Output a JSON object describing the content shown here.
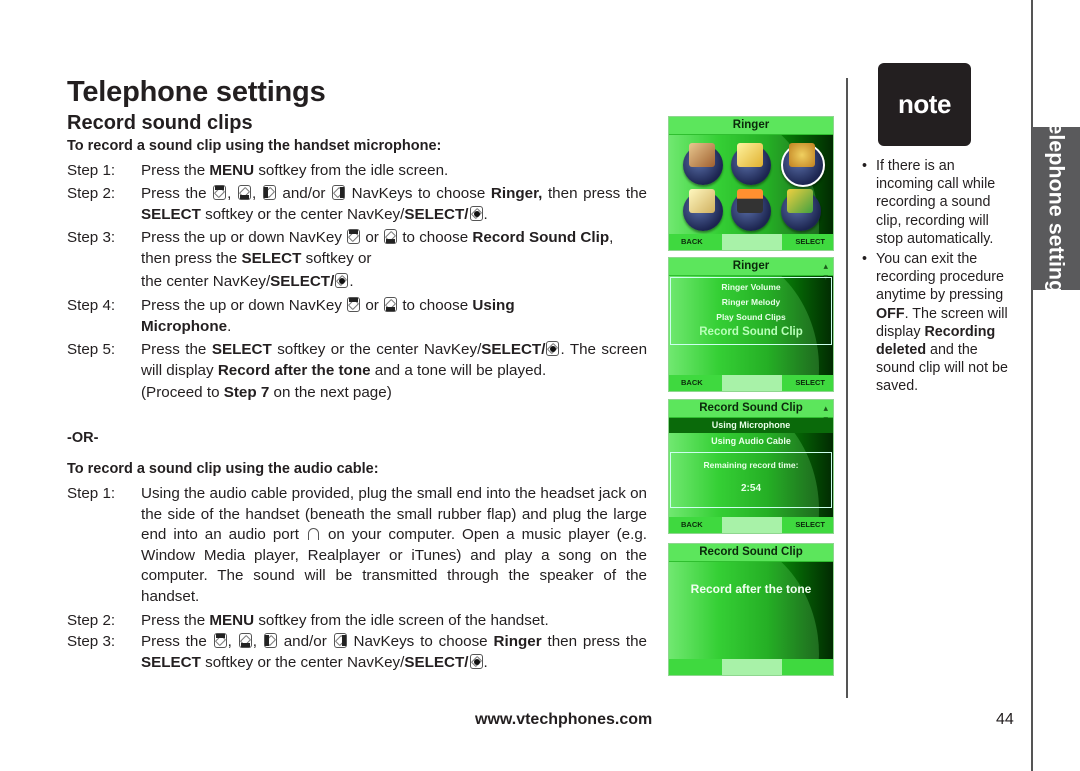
{
  "header": {
    "title": "Telephone settings",
    "subtitle": "Record sound clips"
  },
  "section_mic": {
    "heading": "To record a sound clip using the handset microphone:",
    "steps": [
      {
        "label": "Step 1:",
        "parts": [
          "Press the ",
          "MENU",
          " softkey from the idle screen."
        ]
      },
      {
        "label": "Step 2:",
        "parts": [
          "Press the ",
          ", ",
          ", ",
          " and/or ",
          " NavKeys to choose ",
          "Ringer,",
          " then press the ",
          "SELECT",
          " softkey or the center NavKey/",
          "SELECT/",
          "."
        ]
      },
      {
        "label": "Step 3:",
        "parts": [
          "Press the up or down NavKey ",
          " or ",
          " to choose ",
          "Record Sound Clip",
          ", then press the ",
          "SELECT",
          " softkey or",
          "the center NavKey/",
          "SELECT/",
          "."
        ]
      },
      {
        "label": "Step 4:",
        "parts": [
          "Press the up or down NavKey ",
          " or ",
          " to choose ",
          "Using Microphone",
          "."
        ]
      },
      {
        "label": "Step 5:",
        "parts": [
          "Press the ",
          "SELECT",
          " softkey or the center NavKey/",
          "SELECT/",
          ". The screen will display ",
          "Record after the tone",
          " and a tone will be played."
        ]
      }
    ],
    "proceed": [
      "(Proceed to ",
      "Step 7",
      " on the next page)"
    ]
  },
  "or_label": "-OR-",
  "section_cable": {
    "heading": "To record a sound clip using the audio cable:",
    "steps": [
      {
        "label": "Step 1:",
        "parts": [
          "Using the audio cable provided, plug the small end into the headset jack on the side of the handset (beneath the small rubber flap) and plug the large end into an audio port ",
          " on your computer. Open a music player (e.g. Window Media player, Realplayer or iTunes) and play a song on the computer. The sound will be transmitted through the speaker of the handset."
        ]
      },
      {
        "label": "Step 2:",
        "parts": [
          "Press the ",
          "MENU",
          " softkey from the idle screen of the handset."
        ]
      },
      {
        "label": "Step 3:",
        "parts": [
          "Press the ",
          ", ",
          ", ",
          " and/or ",
          " NavKeys to choose ",
          "Ringer",
          " then press the ",
          "SELECT",
          " softkey or the center NavKey/",
          "SELECT/",
          "."
        ]
      }
    ]
  },
  "screens": [
    {
      "title": "Ringer",
      "softkeys": {
        "left": "BACK",
        "right": "SELECT"
      },
      "icons": [
        "directory-icon",
        "messages-icon",
        "ringer-icon",
        "settings-icon",
        "handset-icon",
        "pictures-icon"
      ]
    },
    {
      "title": "Ringer",
      "softkeys": {
        "left": "BACK",
        "right": "SELECT"
      },
      "items": [
        "Ringer Volume",
        "Ringer Melody",
        "Play Sound Clips",
        "Record Sound Clip"
      ],
      "selected": "Record Sound Clip"
    },
    {
      "title": "Record Sound Clip",
      "softkeys": {
        "left": "BACK",
        "right": "SELECT"
      },
      "items": [
        "Using Microphone",
        "Using Audio Cable"
      ],
      "selected": "Using Microphone",
      "remaining_label": "Remaining record time:",
      "remaining_value": "2:54"
    },
    {
      "title": "Record Sound Clip",
      "message": "Record after the tone"
    }
  ],
  "note": {
    "label": "note",
    "items": [
      [
        "If there is an incoming call while recording a sound clip, recording will stop automatically."
      ],
      [
        "You can exit the recording procedure anytime by pressing ",
        "OFF",
        ". The screen will display ",
        "Recording deleted",
        " and the sound clip will not be saved."
      ]
    ]
  },
  "side_tab": "Telephone settings",
  "footer": {
    "url": "www.vtechphones.com",
    "page": "44"
  }
}
